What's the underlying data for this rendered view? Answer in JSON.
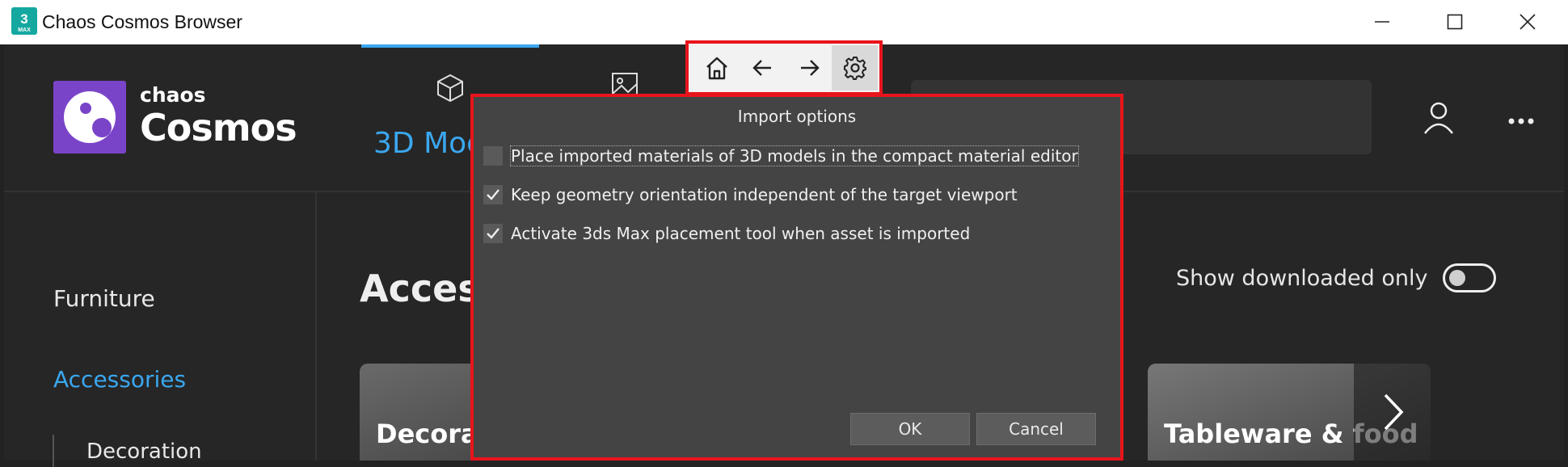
{
  "window": {
    "title": "Chaos Cosmos Browser",
    "app_icon_text": "3",
    "app_icon_sub": "MAX"
  },
  "brand": {
    "small": "chaos",
    "big": "Cosmos",
    "color": "#7a44c9"
  },
  "tabs": [
    {
      "label": "3D Moc",
      "active": true,
      "icon": "cube-icon"
    },
    {
      "label": "",
      "icon": "image-icon"
    }
  ],
  "accent_color": "#3aa7f0",
  "nav_toolbar": {
    "buttons": [
      "home-icon",
      "arrow-left-icon",
      "arrow-right-icon",
      "gear-icon"
    ],
    "highlight_color": "#e8141c"
  },
  "sidebar": {
    "items": [
      {
        "label": "Furniture"
      },
      {
        "label": "Accessories",
        "active": true
      },
      {
        "label": "Decoration"
      }
    ]
  },
  "main": {
    "title": "Acces",
    "show_downloaded_label": "Show downloaded only",
    "toggle_on": false,
    "cards": [
      {
        "title": "Decora"
      },
      {
        "title": "Tableware & food"
      }
    ]
  },
  "dialog": {
    "title": "Import options",
    "options": [
      {
        "label": "Place imported materials of 3D models in the compact material editor",
        "checked": false
      },
      {
        "label": "Keep geometry orientation independent of the target viewport",
        "checked": true
      },
      {
        "label": "Activate 3ds Max placement tool when asset is imported",
        "checked": true
      }
    ],
    "ok_label": "OK",
    "cancel_label": "Cancel"
  }
}
